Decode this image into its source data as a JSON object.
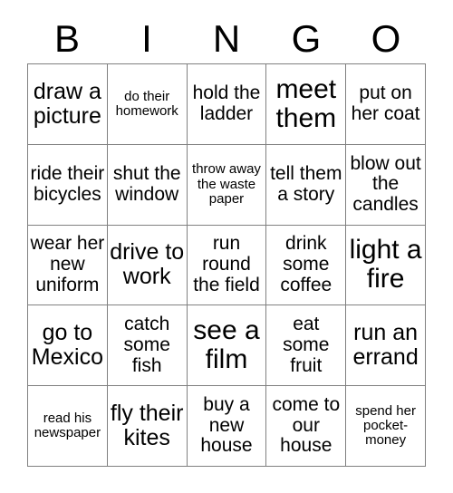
{
  "card": {
    "title": "BINGO Card",
    "header_letters": [
      "B",
      "I",
      "N",
      "G",
      "O"
    ],
    "grid": {
      "columns": 5,
      "rows": 5,
      "border_color": "#808080",
      "background_color": "#ffffff",
      "text_color": "#000000"
    },
    "cells": [
      {
        "text": "draw a picture",
        "size": "fs-lg"
      },
      {
        "text": "do their homework",
        "size": "fs-xs"
      },
      {
        "text": "hold the ladder",
        "size": "fs-md"
      },
      {
        "text": "meet them",
        "size": "fs-xl"
      },
      {
        "text": "put on her coat",
        "size": "fs-md"
      },
      {
        "text": "ride their bicycles",
        "size": "fs-md"
      },
      {
        "text": "shut the window",
        "size": "fs-md"
      },
      {
        "text": "throw away the waste paper",
        "size": "fs-xs"
      },
      {
        "text": "tell them a story",
        "size": "fs-md"
      },
      {
        "text": "blow out the candles",
        "size": "fs-md"
      },
      {
        "text": "wear her new uniform",
        "size": "fs-md"
      },
      {
        "text": "drive to work",
        "size": "fs-lg"
      },
      {
        "text": "run round the field",
        "size": "fs-md"
      },
      {
        "text": "drink some coffee",
        "size": "fs-md"
      },
      {
        "text": "light a fire",
        "size": "fs-xl"
      },
      {
        "text": "go to Mexico",
        "size": "fs-lg"
      },
      {
        "text": "catch some fish",
        "size": "fs-md"
      },
      {
        "text": "see a film",
        "size": "fs-xl"
      },
      {
        "text": "eat some fruit",
        "size": "fs-md"
      },
      {
        "text": "run an errand",
        "size": "fs-lg"
      },
      {
        "text": "read his newspaper",
        "size": "fs-xs"
      },
      {
        "text": "fly their kites",
        "size": "fs-lg"
      },
      {
        "text": "buy a new house",
        "size": "fs-md"
      },
      {
        "text": "come to our house",
        "size": "fs-md"
      },
      {
        "text": "spend her pocket-money",
        "size": "fs-xs"
      }
    ]
  }
}
